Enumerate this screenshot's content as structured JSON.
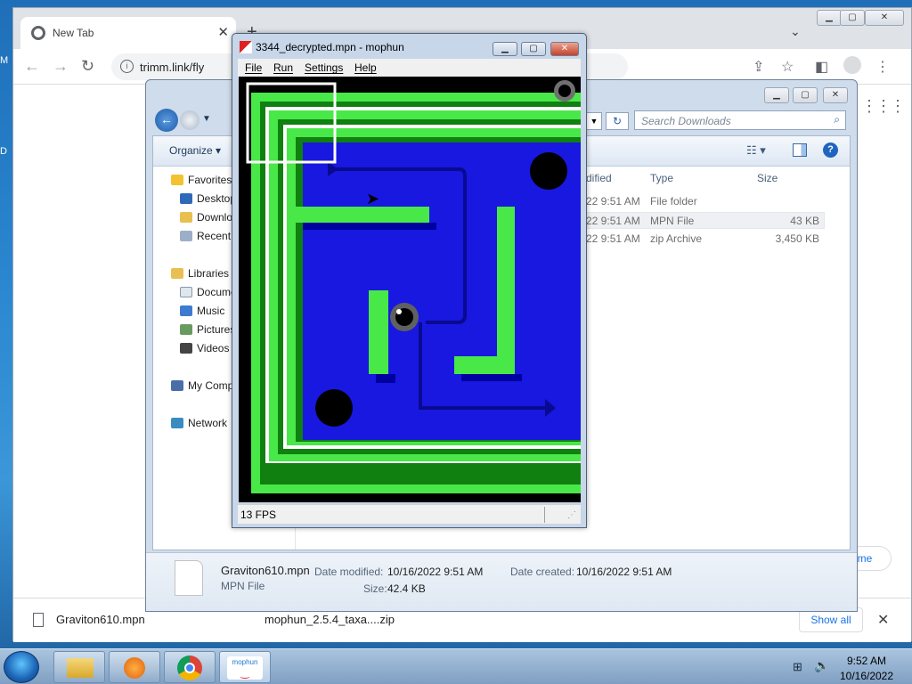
{
  "desktop": {
    "edge_label_1": "M",
    "edge_label_2": "D"
  },
  "chrome": {
    "tab_title": "New Tab",
    "url": "trimm.link/fly",
    "download_items": [
      "Graviton610.mpn",
      "mophun_2.5.4_taxa....zip"
    ],
    "show_all_label": "Show all",
    "side_peek_label": "me"
  },
  "explorer": {
    "organize_label": "Organize",
    "search_placeholder": "Search Downloads",
    "sidebar": {
      "favorites": "Favorites",
      "desktop": "Desktop",
      "downloads": "Downloads",
      "recent": "Recent",
      "libraries": "Libraries",
      "documents": "Documents",
      "music": "Music",
      "pictures": "Pictures",
      "videos": "Videos",
      "my_computer": "My Computer",
      "network": "Network"
    },
    "columns": {
      "modified": "dified",
      "type": "Type",
      "size": "Size"
    },
    "rows": [
      {
        "modified": "22 9:51 AM",
        "type": "File folder",
        "size": ""
      },
      {
        "modified": "22 9:51 AM",
        "type": "MPN File",
        "size": "43 KB"
      },
      {
        "modified": "22 9:51 AM",
        "type": "zip Archive",
        "size": "3,450 KB"
      }
    ],
    "details": {
      "filename": "Graviton610.mpn",
      "filetype": "MPN File",
      "date_modified_label": "Date modified:",
      "date_modified": "10/16/2022 9:51 AM",
      "date_created_label": "Date created:",
      "date_created": "10/16/2022 9:51 AM",
      "size_label": "Size:",
      "size": "42.4 KB"
    }
  },
  "mophun": {
    "title": "3344_decrypted.mpn - mophun",
    "menu": [
      "File",
      "Run",
      "Settings",
      "Help"
    ],
    "fps": "13 FPS"
  },
  "taskbar": {
    "time": "9:52 AM",
    "date": "10/16/2022",
    "mophun_logo": "mophun"
  },
  "colors": {
    "maze_blue": "#1818e0",
    "maze_green": "#48e848",
    "maze_darkgreen": "#108010"
  }
}
